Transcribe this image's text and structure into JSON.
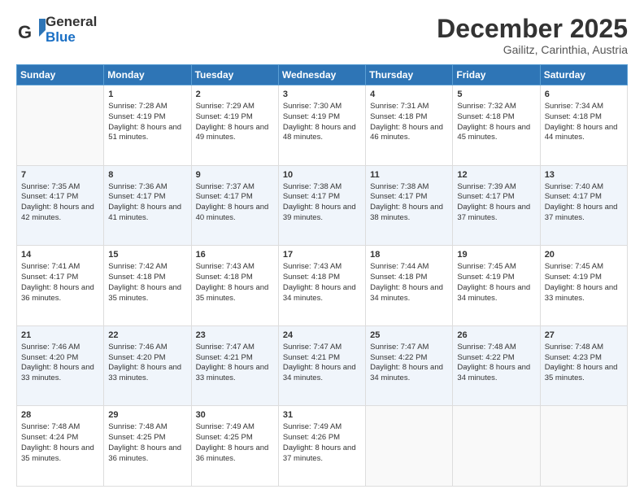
{
  "header": {
    "logo_general": "General",
    "logo_blue": "Blue",
    "month": "December 2025",
    "location": "Gailitz, Carinthia, Austria"
  },
  "days_of_week": [
    "Sunday",
    "Monday",
    "Tuesday",
    "Wednesday",
    "Thursday",
    "Friday",
    "Saturday"
  ],
  "weeks": [
    [
      {
        "day": "",
        "sunrise": "",
        "sunset": "",
        "daylight": ""
      },
      {
        "day": "1",
        "sunrise": "Sunrise: 7:28 AM",
        "sunset": "Sunset: 4:19 PM",
        "daylight": "Daylight: 8 hours and 51 minutes."
      },
      {
        "day": "2",
        "sunrise": "Sunrise: 7:29 AM",
        "sunset": "Sunset: 4:19 PM",
        "daylight": "Daylight: 8 hours and 49 minutes."
      },
      {
        "day": "3",
        "sunrise": "Sunrise: 7:30 AM",
        "sunset": "Sunset: 4:19 PM",
        "daylight": "Daylight: 8 hours and 48 minutes."
      },
      {
        "day": "4",
        "sunrise": "Sunrise: 7:31 AM",
        "sunset": "Sunset: 4:18 PM",
        "daylight": "Daylight: 8 hours and 46 minutes."
      },
      {
        "day": "5",
        "sunrise": "Sunrise: 7:32 AM",
        "sunset": "Sunset: 4:18 PM",
        "daylight": "Daylight: 8 hours and 45 minutes."
      },
      {
        "day": "6",
        "sunrise": "Sunrise: 7:34 AM",
        "sunset": "Sunset: 4:18 PM",
        "daylight": "Daylight: 8 hours and 44 minutes."
      }
    ],
    [
      {
        "day": "7",
        "sunrise": "Sunrise: 7:35 AM",
        "sunset": "Sunset: 4:17 PM",
        "daylight": "Daylight: 8 hours and 42 minutes."
      },
      {
        "day": "8",
        "sunrise": "Sunrise: 7:36 AM",
        "sunset": "Sunset: 4:17 PM",
        "daylight": "Daylight: 8 hours and 41 minutes."
      },
      {
        "day": "9",
        "sunrise": "Sunrise: 7:37 AM",
        "sunset": "Sunset: 4:17 PM",
        "daylight": "Daylight: 8 hours and 40 minutes."
      },
      {
        "day": "10",
        "sunrise": "Sunrise: 7:38 AM",
        "sunset": "Sunset: 4:17 PM",
        "daylight": "Daylight: 8 hours and 39 minutes."
      },
      {
        "day": "11",
        "sunrise": "Sunrise: 7:38 AM",
        "sunset": "Sunset: 4:17 PM",
        "daylight": "Daylight: 8 hours and 38 minutes."
      },
      {
        "day": "12",
        "sunrise": "Sunrise: 7:39 AM",
        "sunset": "Sunset: 4:17 PM",
        "daylight": "Daylight: 8 hours and 37 minutes."
      },
      {
        "day": "13",
        "sunrise": "Sunrise: 7:40 AM",
        "sunset": "Sunset: 4:17 PM",
        "daylight": "Daylight: 8 hours and 37 minutes."
      }
    ],
    [
      {
        "day": "14",
        "sunrise": "Sunrise: 7:41 AM",
        "sunset": "Sunset: 4:17 PM",
        "daylight": "Daylight: 8 hours and 36 minutes."
      },
      {
        "day": "15",
        "sunrise": "Sunrise: 7:42 AM",
        "sunset": "Sunset: 4:18 PM",
        "daylight": "Daylight: 8 hours and 35 minutes."
      },
      {
        "day": "16",
        "sunrise": "Sunrise: 7:43 AM",
        "sunset": "Sunset: 4:18 PM",
        "daylight": "Daylight: 8 hours and 35 minutes."
      },
      {
        "day": "17",
        "sunrise": "Sunrise: 7:43 AM",
        "sunset": "Sunset: 4:18 PM",
        "daylight": "Daylight: 8 hours and 34 minutes."
      },
      {
        "day": "18",
        "sunrise": "Sunrise: 7:44 AM",
        "sunset": "Sunset: 4:18 PM",
        "daylight": "Daylight: 8 hours and 34 minutes."
      },
      {
        "day": "19",
        "sunrise": "Sunrise: 7:45 AM",
        "sunset": "Sunset: 4:19 PM",
        "daylight": "Daylight: 8 hours and 34 minutes."
      },
      {
        "day": "20",
        "sunrise": "Sunrise: 7:45 AM",
        "sunset": "Sunset: 4:19 PM",
        "daylight": "Daylight: 8 hours and 33 minutes."
      }
    ],
    [
      {
        "day": "21",
        "sunrise": "Sunrise: 7:46 AM",
        "sunset": "Sunset: 4:20 PM",
        "daylight": "Daylight: 8 hours and 33 minutes."
      },
      {
        "day": "22",
        "sunrise": "Sunrise: 7:46 AM",
        "sunset": "Sunset: 4:20 PM",
        "daylight": "Daylight: 8 hours and 33 minutes."
      },
      {
        "day": "23",
        "sunrise": "Sunrise: 7:47 AM",
        "sunset": "Sunset: 4:21 PM",
        "daylight": "Daylight: 8 hours and 33 minutes."
      },
      {
        "day": "24",
        "sunrise": "Sunrise: 7:47 AM",
        "sunset": "Sunset: 4:21 PM",
        "daylight": "Daylight: 8 hours and 34 minutes."
      },
      {
        "day": "25",
        "sunrise": "Sunrise: 7:47 AM",
        "sunset": "Sunset: 4:22 PM",
        "daylight": "Daylight: 8 hours and 34 minutes."
      },
      {
        "day": "26",
        "sunrise": "Sunrise: 7:48 AM",
        "sunset": "Sunset: 4:22 PM",
        "daylight": "Daylight: 8 hours and 34 minutes."
      },
      {
        "day": "27",
        "sunrise": "Sunrise: 7:48 AM",
        "sunset": "Sunset: 4:23 PM",
        "daylight": "Daylight: 8 hours and 35 minutes."
      }
    ],
    [
      {
        "day": "28",
        "sunrise": "Sunrise: 7:48 AM",
        "sunset": "Sunset: 4:24 PM",
        "daylight": "Daylight: 8 hours and 35 minutes."
      },
      {
        "day": "29",
        "sunrise": "Sunrise: 7:48 AM",
        "sunset": "Sunset: 4:25 PM",
        "daylight": "Daylight: 8 hours and 36 minutes."
      },
      {
        "day": "30",
        "sunrise": "Sunrise: 7:49 AM",
        "sunset": "Sunset: 4:25 PM",
        "daylight": "Daylight: 8 hours and 36 minutes."
      },
      {
        "day": "31",
        "sunrise": "Sunrise: 7:49 AM",
        "sunset": "Sunset: 4:26 PM",
        "daylight": "Daylight: 8 hours and 37 minutes."
      },
      {
        "day": "",
        "sunrise": "",
        "sunset": "",
        "daylight": ""
      },
      {
        "day": "",
        "sunrise": "",
        "sunset": "",
        "daylight": ""
      },
      {
        "day": "",
        "sunrise": "",
        "sunset": "",
        "daylight": ""
      }
    ]
  ]
}
